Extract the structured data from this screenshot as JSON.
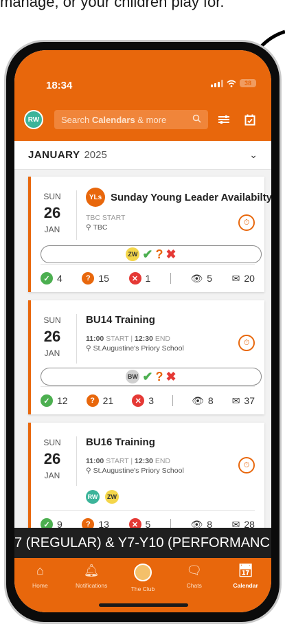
{
  "caption": "manage, or your children play for.",
  "status": {
    "time": "18:34",
    "battery": "38"
  },
  "header": {
    "me_initials": "RW",
    "search_prefix": "Search ",
    "search_bold": "Calendars",
    "search_suffix": " & more"
  },
  "month": {
    "name": "JANUARY",
    "year": "2025"
  },
  "events": [
    {
      "dow": "SUN",
      "day": "26",
      "mon": "JAN",
      "org_initials": "YLs",
      "title": "Sunday Young Leader Availabilty",
      "start": "TBC",
      "start_label": "START",
      "location": "TBC",
      "people": [
        "ZW"
      ],
      "counts": {
        "yes": "4",
        "maybe": "15",
        "no": "1",
        "views": "5",
        "messages": "20"
      }
    },
    {
      "dow": "SUN",
      "day": "26",
      "mon": "JAN",
      "title": "BU14 Training",
      "start": "11:00",
      "start_label": "START",
      "end": "12:30",
      "end_label": "END",
      "location": "St.Augustine's Priory School",
      "people": [
        "BW"
      ],
      "counts": {
        "yes": "12",
        "maybe": "21",
        "no": "3",
        "views": "8",
        "messages": "37"
      }
    },
    {
      "dow": "SUN",
      "day": "26",
      "mon": "JAN",
      "title": "BU16 Training",
      "start": "11:00",
      "start_label": "START",
      "end": "12:30",
      "end_label": "END",
      "location": "St.Augustine's Priory School",
      "people": [
        "RW",
        "ZW"
      ],
      "counts": {
        "yes": "9",
        "maybe": "13",
        "no": "5",
        "views": "8",
        "messages": "28"
      }
    }
  ],
  "banner": "7 (REGULAR) & Y7-Y10 (PERFORMANC",
  "tabs": [
    {
      "label": "Home",
      "icon": "home-icon"
    },
    {
      "label": "Notifications",
      "icon": "bell-icon"
    },
    {
      "label": "The Club",
      "icon": "club-crest-icon"
    },
    {
      "label": "Chats",
      "icon": "chat-icon"
    },
    {
      "label": "Calendar",
      "icon": "calendar-icon"
    }
  ],
  "colors": {
    "brand": "#e8670c",
    "yes": "#4caf50",
    "no": "#e53935"
  }
}
